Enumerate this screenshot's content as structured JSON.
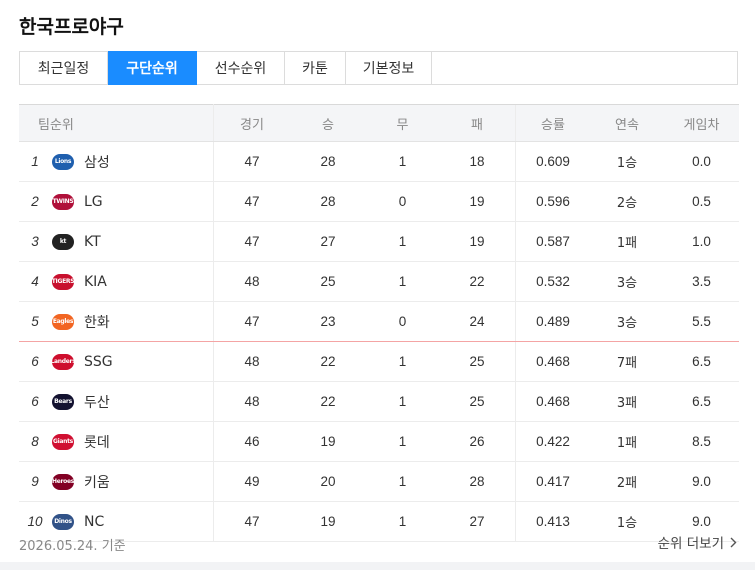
{
  "title": "한국프로야구",
  "tabs": [
    "최근일정",
    "구단순위",
    "선수순위",
    "카툰",
    "기본정보"
  ],
  "active_tab": 1,
  "headers": {
    "team": "팀순위",
    "games": "경기",
    "wins": "승",
    "draws": "무",
    "losses": "패",
    "pct": "승률",
    "streak": "연속",
    "gb": "게임차"
  },
  "rows": [
    {
      "rank": "1",
      "team": "삼성",
      "games": "47",
      "wins": "28",
      "draws": "1",
      "losses": "18",
      "pct": "0.609",
      "streak": "1승",
      "gb": "0.0",
      "logo": {
        "name": "lions-logo",
        "text": "Lions",
        "color": "#1f5fae"
      }
    },
    {
      "rank": "2",
      "team": "LG",
      "games": "47",
      "wins": "28",
      "draws": "0",
      "losses": "19",
      "pct": "0.596",
      "streak": "2승",
      "gb": "0.5",
      "logo": {
        "name": "twins-logo",
        "text": "TWINS",
        "color": "#b0103a"
      }
    },
    {
      "rank": "3",
      "team": "KT",
      "games": "47",
      "wins": "27",
      "draws": "1",
      "losses": "19",
      "pct": "0.587",
      "streak": "1패",
      "gb": "1.0",
      "logo": {
        "name": "kt-wiz-logo",
        "text": "kt",
        "color": "#222222"
      }
    },
    {
      "rank": "4",
      "team": "KIA",
      "games": "48",
      "wins": "25",
      "draws": "1",
      "losses": "22",
      "pct": "0.532",
      "streak": "3승",
      "gb": "3.5",
      "logo": {
        "name": "tigers-logo",
        "text": "TIGERS",
        "color": "#c8102e"
      }
    },
    {
      "rank": "5",
      "team": "한화",
      "games": "47",
      "wins": "23",
      "draws": "0",
      "losses": "24",
      "pct": "0.489",
      "streak": "3승",
      "gb": "5.5",
      "logo": {
        "name": "eagles-logo",
        "text": "Eagles",
        "color": "#f26522"
      }
    },
    {
      "rank": "6",
      "team": "SSG",
      "games": "48",
      "wins": "22",
      "draws": "1",
      "losses": "25",
      "pct": "0.468",
      "streak": "7패",
      "gb": "6.5",
      "logo": {
        "name": "landers-logo",
        "text": "Landers",
        "color": "#ce0e2d"
      }
    },
    {
      "rank": "6",
      "team": "두산",
      "games": "48",
      "wins": "22",
      "draws": "1",
      "losses": "25",
      "pct": "0.468",
      "streak": "3패",
      "gb": "6.5",
      "logo": {
        "name": "bears-logo",
        "text": "Bears",
        "color": "#131230"
      }
    },
    {
      "rank": "8",
      "team": "롯데",
      "games": "46",
      "wins": "19",
      "draws": "1",
      "losses": "26",
      "pct": "0.422",
      "streak": "1패",
      "gb": "8.5",
      "logo": {
        "name": "giants-logo",
        "text": "Giants",
        "color": "#d00f31"
      }
    },
    {
      "rank": "9",
      "team": "키움",
      "games": "49",
      "wins": "20",
      "draws": "1",
      "losses": "28",
      "pct": "0.417",
      "streak": "2패",
      "gb": "9.0",
      "logo": {
        "name": "heroes-logo",
        "text": "Heroes",
        "color": "#820024"
      }
    },
    {
      "rank": "10",
      "team": "NC",
      "games": "47",
      "wins": "19",
      "draws": "1",
      "losses": "27",
      "pct": "0.413",
      "streak": "1승",
      "gb": "9.0",
      "logo": {
        "name": "dinos-logo",
        "text": "Dinos",
        "color": "#315288"
      }
    }
  ],
  "footer": {
    "date": "2026.05.24. 기준",
    "more": "순위 더보기"
  }
}
